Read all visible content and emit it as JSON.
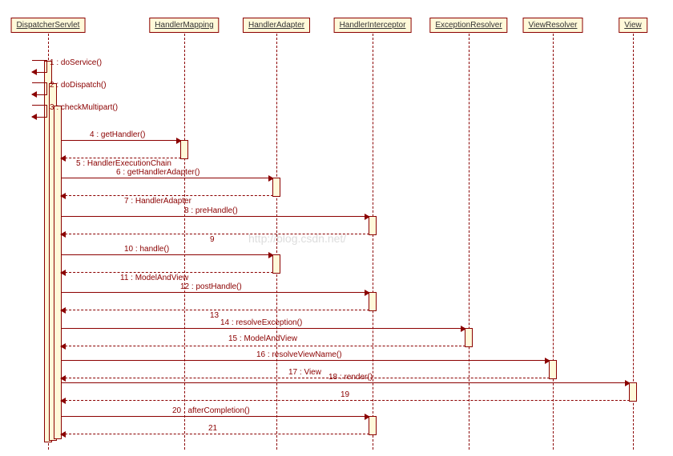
{
  "participants": {
    "dispatcher": "DispatcherServlet",
    "mapping": "HandlerMapping",
    "adapter": "HandlerAdapter",
    "interceptor": "HandlerInterceptor",
    "exception": "ExceptionResolver",
    "viewresolver": "ViewResolver",
    "view": "View"
  },
  "messages": {
    "m1": "1 : doService()",
    "m2": "2 : doDispatch()",
    "m3": "3 : checkMultipart()",
    "m4": "4 : getHandler()",
    "m5": "5 : HandlerExecutionChain",
    "m6": "6 : getHandlerAdapter()",
    "m7": "7 : HandlerAdapter",
    "m8": "8 : preHandle()",
    "m9": "9",
    "m10": "10 : handle()",
    "m11": "11 : ModelAndView",
    "m12": "12 : postHandle()",
    "m13": "13",
    "m14": "14 : resolveException()",
    "m15": "15 : ModelAndView",
    "m16": "16 : resolveViewName()",
    "m17": "17 : View",
    "m18": "18 : render()",
    "m19": "19",
    "m20": "20 : afterCompletion()",
    "m21": "21"
  },
  "watermark": "http://blog.csdn.net/",
  "chart_data": {
    "type": "sequence",
    "participants": [
      "DispatcherServlet",
      "HandlerMapping",
      "HandlerAdapter",
      "HandlerInterceptor",
      "ExceptionResolver",
      "ViewResolver",
      "View"
    ],
    "interactions": [
      {
        "n": 1,
        "from": "DispatcherServlet",
        "to": "DispatcherServlet",
        "label": "doService()",
        "kind": "self"
      },
      {
        "n": 2,
        "from": "DispatcherServlet",
        "to": "DispatcherServlet",
        "label": "doDispatch()",
        "kind": "self"
      },
      {
        "n": 3,
        "from": "DispatcherServlet",
        "to": "DispatcherServlet",
        "label": "checkMultipart()",
        "kind": "self"
      },
      {
        "n": 4,
        "from": "DispatcherServlet",
        "to": "HandlerMapping",
        "label": "getHandler()",
        "kind": "call"
      },
      {
        "n": 5,
        "from": "HandlerMapping",
        "to": "DispatcherServlet",
        "label": "HandlerExecutionChain",
        "kind": "return"
      },
      {
        "n": 6,
        "from": "DispatcherServlet",
        "to": "HandlerAdapter",
        "label": "getHandlerAdapter()",
        "kind": "call"
      },
      {
        "n": 7,
        "from": "HandlerAdapter",
        "to": "DispatcherServlet",
        "label": "HandlerAdapter",
        "kind": "return"
      },
      {
        "n": 8,
        "from": "DispatcherServlet",
        "to": "HandlerInterceptor",
        "label": "preHandle()",
        "kind": "call"
      },
      {
        "n": 9,
        "from": "HandlerInterceptor",
        "to": "DispatcherServlet",
        "label": "",
        "kind": "return"
      },
      {
        "n": 10,
        "from": "DispatcherServlet",
        "to": "HandlerAdapter",
        "label": "handle()",
        "kind": "call"
      },
      {
        "n": 11,
        "from": "HandlerAdapter",
        "to": "DispatcherServlet",
        "label": "ModelAndView",
        "kind": "return"
      },
      {
        "n": 12,
        "from": "DispatcherServlet",
        "to": "HandlerInterceptor",
        "label": "postHandle()",
        "kind": "call"
      },
      {
        "n": 13,
        "from": "HandlerInterceptor",
        "to": "DispatcherServlet",
        "label": "",
        "kind": "return"
      },
      {
        "n": 14,
        "from": "DispatcherServlet",
        "to": "ExceptionResolver",
        "label": "resolveException()",
        "kind": "call"
      },
      {
        "n": 15,
        "from": "ExceptionResolver",
        "to": "DispatcherServlet",
        "label": "ModelAndView",
        "kind": "return"
      },
      {
        "n": 16,
        "from": "DispatcherServlet",
        "to": "ViewResolver",
        "label": "resolveViewName()",
        "kind": "call"
      },
      {
        "n": 17,
        "from": "ViewResolver",
        "to": "DispatcherServlet",
        "label": "View",
        "kind": "return"
      },
      {
        "n": 18,
        "from": "DispatcherServlet",
        "to": "View",
        "label": "render()",
        "kind": "call"
      },
      {
        "n": 19,
        "from": "View",
        "to": "DispatcherServlet",
        "label": "",
        "kind": "return"
      },
      {
        "n": 20,
        "from": "DispatcherServlet",
        "to": "HandlerInterceptor",
        "label": "afterCompletion()",
        "kind": "call"
      },
      {
        "n": 21,
        "from": "HandlerInterceptor",
        "to": "DispatcherServlet",
        "label": "",
        "kind": "return"
      }
    ]
  }
}
